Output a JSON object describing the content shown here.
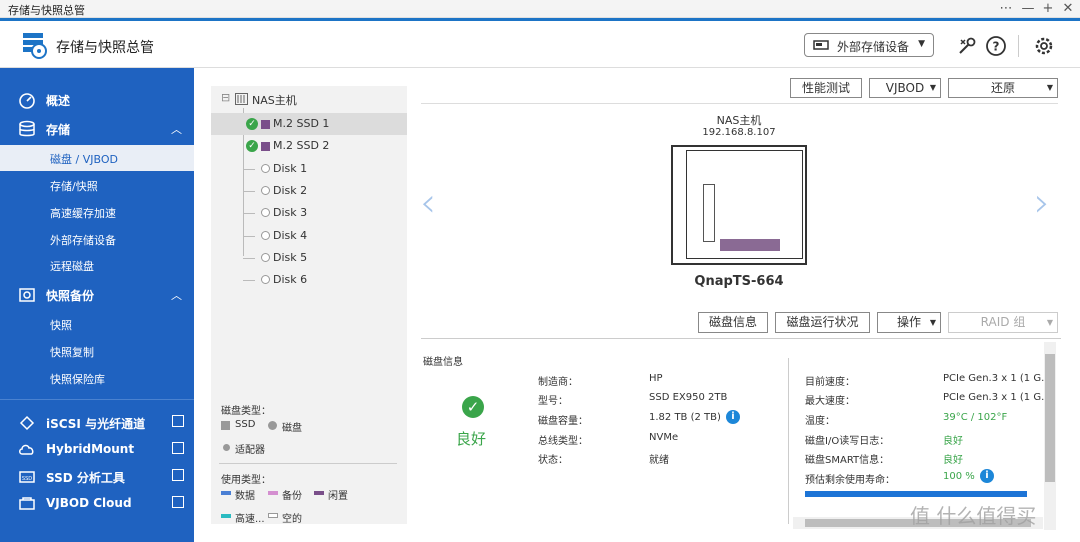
{
  "window": {
    "title": "存储与快照总管",
    "controls": [
      "⋯",
      "—",
      "+",
      "✕"
    ]
  },
  "header": {
    "app_title": "存储与快照总管",
    "external_device_button": "外部存储设备"
  },
  "sidebar": {
    "sections": [
      {
        "label": "概述"
      },
      {
        "label": "存储",
        "items": [
          "磁盘 / VJBOD",
          "存储/快照",
          "高速缓存加速",
          "外部存储设备",
          "远程磁盘"
        ]
      },
      {
        "label": "快照备份",
        "items": [
          "快照",
          "快照复制",
          "快照保险库"
        ]
      }
    ],
    "external_links": [
      "iSCSI 与光纤通道",
      "HybridMount",
      "SSD 分析工具",
      "VJBOD Cloud"
    ]
  },
  "tree": {
    "root": "NAS主机",
    "disks": [
      "M.2 SSD 1",
      "M.2 SSD 2",
      "Disk 1",
      "Disk 2",
      "Disk 3",
      "Disk 4",
      "Disk 5",
      "Disk 6"
    ],
    "legend_disk_type_title": "磁盘类型：",
    "legend_disk_types": [
      "SSD",
      "磁盘",
      "适配器"
    ],
    "legend_usage_title": "使用类型：",
    "legend_usage": [
      "数据",
      "备份",
      "闲置",
      "高速...",
      "空的"
    ]
  },
  "toolbar": {
    "perf_test": "性能测试",
    "vjbod": "VJBOD",
    "restore": "还原"
  },
  "nas": {
    "name": "NAS主机",
    "ip": "192.168.8.107",
    "model": "QnapTS-664"
  },
  "info_buttons": {
    "disk_info": "磁盘信息",
    "disk_health": "磁盘运行状况",
    "action": "操作",
    "raid_group": "RAID 组"
  },
  "info": {
    "title": "磁盘信息",
    "status": "良好",
    "fields": [
      {
        "label": "制造商：",
        "value": "HP"
      },
      {
        "label": "型号：",
        "value": "SSD EX950 2TB"
      },
      {
        "label": "磁盘容量：",
        "value": "1.82 TB (2 TB)"
      },
      {
        "label": "总线类型：",
        "value": "NVMe"
      },
      {
        "label": "状态：",
        "value": "就绪"
      }
    ],
    "right_fields": [
      {
        "label": "目前速度：",
        "value": "PCIe Gen.3 x 1 (1 G..."
      },
      {
        "label": "最大速度：",
        "value": "PCIe Gen.3 x 1 (1 G..."
      },
      {
        "label": "温度：",
        "value": "39°C / 102°F"
      },
      {
        "label": "磁盘I/O读写日志：",
        "value": "良好"
      },
      {
        "label": "磁盘SMART信息：",
        "value": "良好"
      },
      {
        "label": "预估剩余使用寿命：",
        "value": "100 %"
      }
    ],
    "life_remaining_fraction": 1.0
  },
  "watermark": "值 什么值得买",
  "colors": {
    "sidebar": "#1f62c0",
    "accent": "#1d74c6",
    "ok": "#3aa54a",
    "ssd_purple": "#7a4f8a"
  }
}
